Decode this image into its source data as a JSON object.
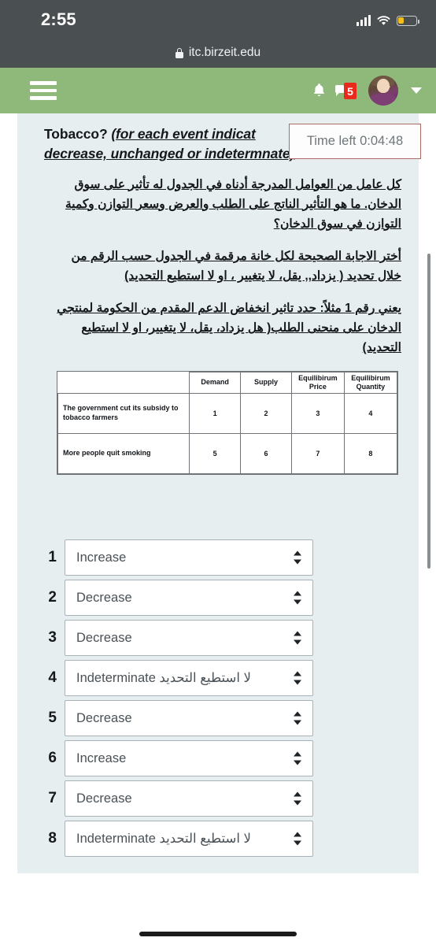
{
  "status_bar": {
    "time": "2:55",
    "signal_icon": "cellular-signal-icon",
    "wifi_icon": "wifi-icon",
    "battery_icon": "battery-low-power-icon"
  },
  "browser": {
    "lock_icon": "lock-icon",
    "url": "itc.birzeit.edu"
  },
  "navbar": {
    "menu_icon": "hamburger-menu-icon",
    "notifications_icon": "bell-icon",
    "messages_icon": "messages-icon",
    "messages_badge": "5",
    "avatar": "user-avatar",
    "account_caret": "chevron-down-icon",
    "bg_color": "#8fb87b"
  },
  "quiz": {
    "timer_label": "Time left 0:04:48",
    "timer_border_color": "#b06a63",
    "question_title_line1_plain": "Tobacco? ",
    "question_title_line1_italic": "(for each event indicat",
    "question_title_line2": "decrease, unchanged or indetermnate)",
    "arabic_paragraph_1": "كل عامل من العوامل المدرجة أدناه في الجدول له تأثير على سوق الدخان. ما هو التأثير الناتج على الطلب والعرض وسعر التوازن وكمية التوازن في سوق الدخان؟",
    "arabic_paragraph_2": "أختر الاجابة الصحيحة لكل خانة مرقمة في الجدول حسب الرقم من خلال تحديد ( يزداد,, يقل، لا يتغيير ، او لا استطيع التحديد)",
    "arabic_paragraph_3": "يعني رقم 1 مثلاً: حدد تاثير انخفاض الدعم المقدم من الحكومة لمنتجي الدخان على منحنى الطلب( هل يزداد، يقل، لا يتغيير، او لا استطيع التحديد)"
  },
  "table": {
    "headers": [
      "",
      "Demand",
      "Supply",
      "Equilibirum Price",
      "Equilibirum Quantity"
    ],
    "rows": [
      {
        "label": "The government cut its subsidy to tobacco farmers",
        "cells": [
          "1",
          "2",
          "3",
          "4"
        ]
      },
      {
        "label": "More people quit smoking",
        "cells": [
          "5",
          "6",
          "7",
          "8"
        ]
      }
    ]
  },
  "answers": [
    {
      "num": "1",
      "value": "Increase"
    },
    {
      "num": "2",
      "value": "Decrease"
    },
    {
      "num": "3",
      "value": "Decrease"
    },
    {
      "num": "4",
      "value": "Indeterminate لا استطيع التحديد"
    },
    {
      "num": "5",
      "value": "Decrease"
    },
    {
      "num": "6",
      "value": "Increase"
    },
    {
      "num": "7",
      "value": "Decrease"
    },
    {
      "num": "8",
      "value": "Indeterminate لا استطيع التحديد"
    }
  ],
  "system": {
    "home_indicator": "home-indicator"
  }
}
